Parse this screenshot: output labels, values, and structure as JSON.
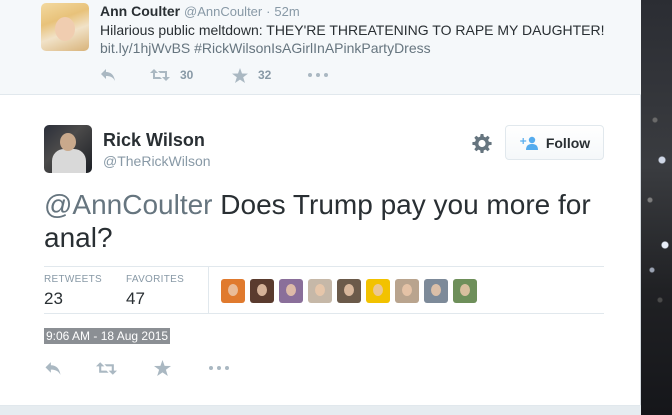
{
  "previous_tweet": {
    "name": "Ann Coulter",
    "handle": "@AnnCoulter",
    "separator": "·",
    "time": "52m",
    "text": "Hilarious public meltdown: THEY'RE THREATENING TO RAPE MY DAUGHTER!",
    "link": "bit.ly/1hjWvBS #RickWilsonIsAGirlInAPinkPartyDress",
    "retweet_count": "30",
    "favorite_count": "32"
  },
  "tweet": {
    "name": "Rick Wilson",
    "handle": "@TheRickWilson",
    "follow_label": "Follow",
    "mention": "@AnnCoulter",
    "text_body": " Does Trump pay you more for anal?",
    "retweets_label": "RETWEETS",
    "retweets_value": "23",
    "favorites_label": "FAVORITES",
    "favorites_value": "47",
    "timestamp": "9:06 AM - 18 Aug 2015"
  },
  "favoriter_avatars": [
    {
      "name": "favoriter-avatar-1",
      "color": "#e07a2e"
    },
    {
      "name": "favoriter-avatar-2",
      "color": "#5a3b2e"
    },
    {
      "name": "favoriter-avatar-3",
      "color": "#8a6f9a"
    },
    {
      "name": "favoriter-avatar-4",
      "color": "#c6b8a8"
    },
    {
      "name": "favoriter-avatar-5",
      "color": "#6b5a4a"
    },
    {
      "name": "favoriter-avatar-6",
      "color": "#f2c200"
    },
    {
      "name": "favoriter-avatar-7",
      "color": "#b9a48e"
    },
    {
      "name": "favoriter-avatar-8",
      "color": "#7d8a99"
    },
    {
      "name": "favoriter-avatar-9",
      "color": "#6e8f5a"
    }
  ],
  "colors": {
    "icon_gray": "#aab8c2",
    "follow_icon_blue": "#55acee",
    "text_dark": "#292f33",
    "text_muted": "#8899a6"
  },
  "icons": {
    "reply": "reply-icon",
    "retweet": "retweet-icon",
    "favorite": "star-icon",
    "more": "more-icon",
    "settings": "gear-icon",
    "follow": "add-user-icon"
  }
}
